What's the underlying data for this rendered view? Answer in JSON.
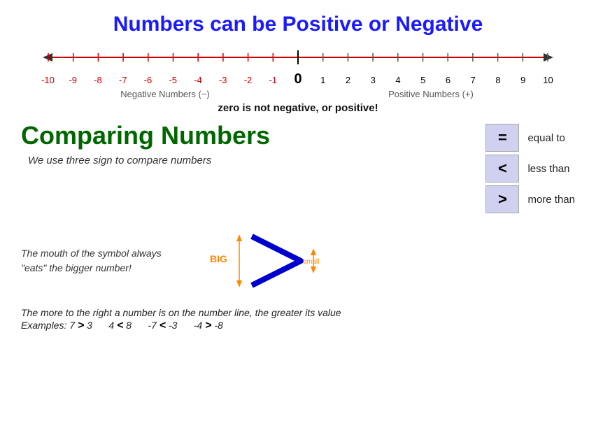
{
  "title": "Numbers can be Positive or Negative",
  "numberLine": {
    "numbers": [
      "-10",
      "-9",
      "-8",
      "-7",
      "-6",
      "-5",
      "-4",
      "-3",
      "-2",
      "-1",
      "0",
      "1",
      "2",
      "3",
      "4",
      "5",
      "6",
      "7",
      "8",
      "9",
      "10"
    ],
    "negLabel": "Negative Numbers (−)",
    "posLabel": "Positive Numbers (+)",
    "zeroNote": "zero is not negative, or positive!"
  },
  "comparing": {
    "title": "Comparing Numbers",
    "desc": "We use three sign to compare numbers",
    "symbols": [
      {
        "symbol": "=",
        "desc": "equal to"
      },
      {
        "symbol": "<",
        "desc": "less than"
      },
      {
        "symbol": ">",
        "desc": "more than"
      }
    ]
  },
  "mouth": {
    "text": "The mouth of the symbol always \"eats\" the bigger number!",
    "bigLabel": "BIG",
    "smallLabel": "small"
  },
  "bottomNote": "The more to the right a number is on the number line, the greater its value",
  "examples": {
    "label": "Examples:",
    "items": [
      {
        "left": "7",
        "sym": ">",
        "right": "3"
      },
      {
        "left": "4",
        "sym": "<",
        "right": "8"
      },
      {
        "left": "-7",
        "sym": "<",
        "right": "-3"
      },
      {
        "left": "-4",
        "sym": ">",
        "right": "-8"
      }
    ]
  }
}
